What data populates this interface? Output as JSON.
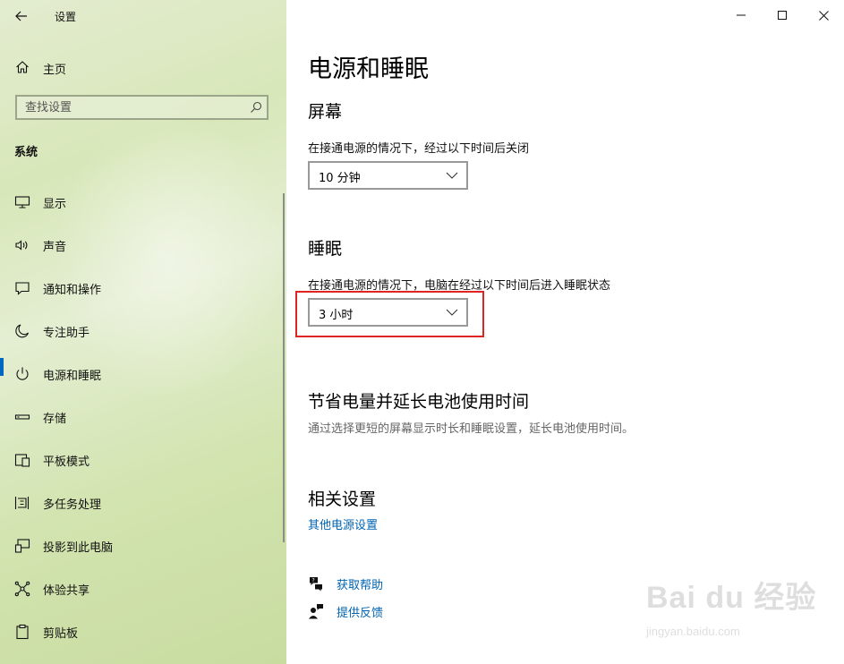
{
  "window": {
    "title": "设置",
    "controls": {
      "minimize": "minimize-icon",
      "maximize": "maximize-icon",
      "close": "close-icon"
    }
  },
  "sidebar": {
    "home_label": "主页",
    "search_placeholder": "查找设置",
    "section_label": "系统",
    "items": [
      {
        "label": "显示",
        "icon": "monitor-icon",
        "active": false
      },
      {
        "label": "声音",
        "icon": "speaker-icon",
        "active": false
      },
      {
        "label": "通知和操作",
        "icon": "notification-icon",
        "active": false
      },
      {
        "label": "专注助手",
        "icon": "moon-icon",
        "active": false
      },
      {
        "label": "电源和睡眠",
        "icon": "power-icon",
        "active": true
      },
      {
        "label": "存储",
        "icon": "storage-icon",
        "active": false
      },
      {
        "label": "平板模式",
        "icon": "tablet-icon",
        "active": false
      },
      {
        "label": "多任务处理",
        "icon": "multitask-icon",
        "active": false
      },
      {
        "label": "投影到此电脑",
        "icon": "project-icon",
        "active": false
      },
      {
        "label": "体验共享",
        "icon": "share-icon",
        "active": false
      },
      {
        "label": "剪贴板",
        "icon": "clipboard-icon",
        "active": false
      }
    ]
  },
  "main": {
    "title": "电源和睡眠",
    "screen": {
      "heading": "屏幕",
      "description": "在接通电源的情况下，经过以下时间后关闭",
      "selected": "10 分钟"
    },
    "sleep": {
      "heading": "睡眠",
      "description": "在接通电源的情况下，电脑在经过以下时间后进入睡眠状态",
      "selected": "3 小时"
    },
    "battery": {
      "heading": "节省电量并延长电池使用时间",
      "description": "通过选择更短的屏幕显示时长和睡眠设置，延长电池使用时间。"
    },
    "related": {
      "heading": "相关设置",
      "link": "其他电源设置"
    },
    "help": {
      "get_help": "获取帮助",
      "feedback": "提供反馈"
    }
  },
  "colors": {
    "accent": "#0067c0",
    "link": "#0063b1",
    "highlight": "#e02424"
  },
  "watermark": {
    "text": "Bai du 经验",
    "sub": "jingyan.baidu.com"
  }
}
